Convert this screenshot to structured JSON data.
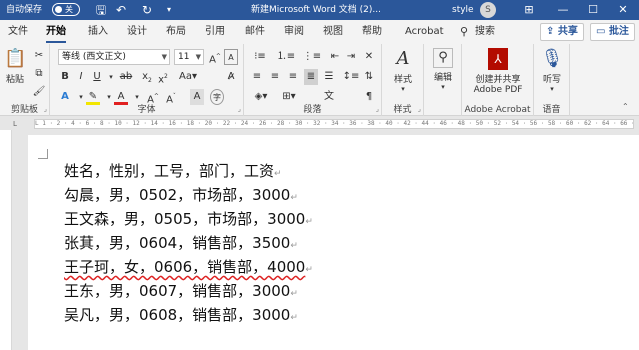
{
  "titlebar": {
    "autosave_label": "自动保存",
    "autosave_state": "关",
    "doc_title": "新建Microsoft Word 文档 (2)...",
    "user_name": "style",
    "avatar_initial": "S",
    "quick_access": [
      "save-icon",
      "undo-icon",
      "redo-icon",
      "customize-icon"
    ],
    "window_buttons": [
      "ribbon-display-icon",
      "minimize-icon",
      "restore-icon",
      "close-icon"
    ]
  },
  "tabs": [
    {
      "label": "文件"
    },
    {
      "label": "开始",
      "active": true
    },
    {
      "label": "插入"
    },
    {
      "label": "设计"
    },
    {
      "label": "布局"
    },
    {
      "label": "引用"
    },
    {
      "label": "邮件"
    },
    {
      "label": "审阅"
    },
    {
      "label": "视图"
    },
    {
      "label": "帮助"
    },
    {
      "label": "Acrobat"
    },
    {
      "label": "搜索"
    }
  ],
  "share_label": "共享",
  "comment_label": "批注",
  "ribbon": {
    "clipboard": {
      "paste_label": "粘贴",
      "group_label": "剪贴板"
    },
    "font": {
      "font_name": "等线 (西文正文)",
      "font_size": "11",
      "group_label": "字体",
      "a_label": "Aa"
    },
    "paragraph": {
      "group_label": "段落"
    },
    "styles": {
      "style_label": "样式",
      "group_label": "样式"
    },
    "editing": {
      "edit_label": "编辑"
    },
    "acrobat": {
      "create_label_1": "创建并共享",
      "create_label_2": "Adobe PDF",
      "group_label": "Adobe Acrobat"
    },
    "voice": {
      "dictate_label": "听写",
      "group_label": "语音"
    }
  },
  "ruler": {
    "marks": "L  1 · 2 · 4 · 6 · 8 · 10 · 12 · 14 · 16 · 18 · 20 · 22 · 24 · 26 · 28 · 30 · 32 · 34 · 36 · 38 · 40 · 42 · 44 · 46 · 48 · 50 · 52 · 54 · 56 · 58 · 60 · 62 · 64 · 66 · 68 · 70 · 72 · 74 · 76 · 78 · 80 · 82 · 84 · 86 · 88 · 90 · 92 · 94 · 96 · 98 ·"
  },
  "document": {
    "lines": [
      "姓名，性别，工号，部门，工资",
      "勾晨，男，0502，市场部，3000",
      "王文森，男，0505，市场部，3000",
      "张萁，男，0604，销售部，3500",
      "王子珂，女，0606，销售部，4000",
      "王东，男，0607，销售部，3000",
      "吴凡，男，0608，销售部，3000"
    ],
    "pilcrow": "↵"
  }
}
